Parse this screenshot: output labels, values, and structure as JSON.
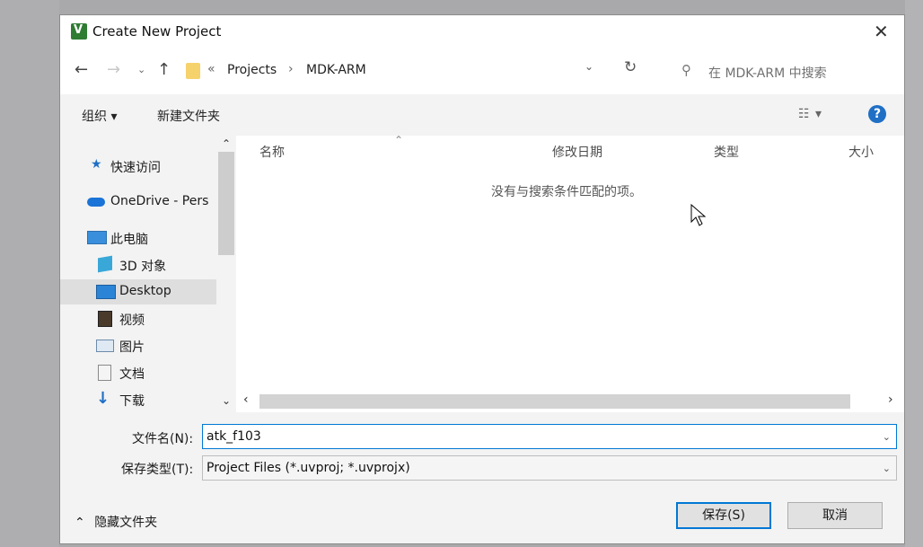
{
  "dialog": {
    "title": "Create New Project"
  },
  "address": {
    "crumbs": [
      "Projects",
      "MDK-ARM"
    ],
    "prefix": "«",
    "search_placeholder": "在 MDK-ARM 中搜索"
  },
  "toolbar": {
    "organize_label": "组织 ▾",
    "new_folder_label": "新建文件夹"
  },
  "nav": {
    "items": [
      {
        "label": "快速访问",
        "icon": "star-icon"
      },
      {
        "label": "OneDrive - Pers",
        "icon": "cloud-icon"
      },
      {
        "label": "此电脑",
        "icon": "computer-icon"
      },
      {
        "label": "3D 对象",
        "icon": "cube-icon"
      },
      {
        "label": "Desktop",
        "icon": "desktop-icon"
      },
      {
        "label": "视频",
        "icon": "video-icon"
      },
      {
        "label": "图片",
        "icon": "picture-icon"
      },
      {
        "label": "文档",
        "icon": "document-icon"
      },
      {
        "label": "下载",
        "icon": "download-icon"
      }
    ]
  },
  "columns": [
    "名称",
    "修改日期",
    "类型",
    "大小"
  ],
  "empty_message": "没有与搜索条件匹配的项。",
  "form": {
    "filename_label": "文件名(N):",
    "filename_value": "atk_f103",
    "filetype_label": "保存类型(T):",
    "filetype_value": "Project Files (*.uvproj; *.uvprojx)"
  },
  "footer": {
    "hide_folders_label": "隐藏文件夹",
    "save_label": "保存(S)",
    "cancel_label": "取消"
  },
  "colors": {
    "accent": "#0078d4",
    "help_blue": "#1f6fc5"
  }
}
